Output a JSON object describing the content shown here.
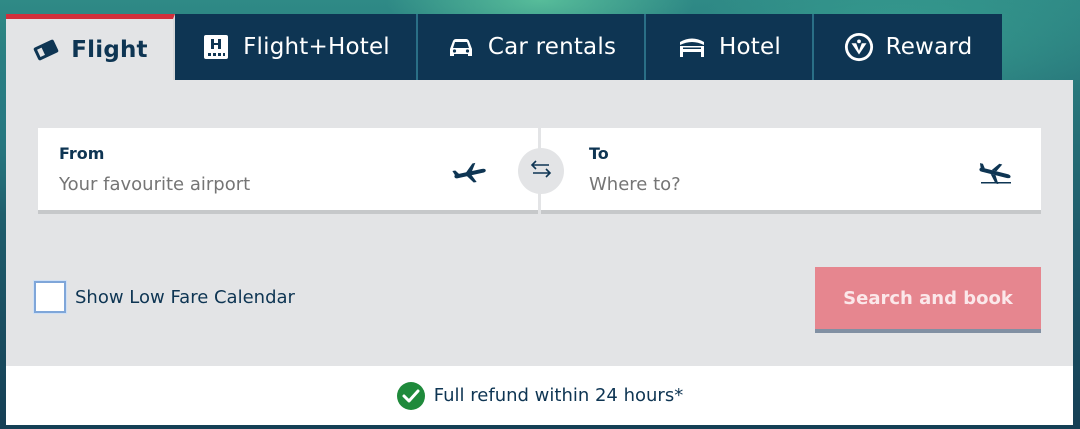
{
  "tabs": [
    {
      "label": "Flight",
      "icon": "ticket-icon",
      "active": true
    },
    {
      "label": "Flight+Hotel",
      "icon": "hotel-building-icon",
      "active": false
    },
    {
      "label": "Car rentals",
      "icon": "car-icon",
      "active": false
    },
    {
      "label": "Hotel",
      "icon": "bed-icon",
      "active": false
    },
    {
      "label": "Reward",
      "icon": "reward-badge-icon",
      "active": false
    }
  ],
  "from": {
    "label": "From",
    "placeholder": "Your favourite airport",
    "icon": "plane-takeoff-icon"
  },
  "to": {
    "label": "To",
    "placeholder": "Where to?",
    "icon": "plane-landing-icon"
  },
  "swap": {
    "icon": "swap-arrows-icon"
  },
  "low_fare": {
    "label": "Show Low Fare Calendar",
    "checked": false
  },
  "search": {
    "label": "Search and book"
  },
  "footer": {
    "text": "Full refund within 24 hours*",
    "icon": "check-circle-icon"
  },
  "colors": {
    "navy": "#0e3553",
    "panel": "#e3e4e6",
    "accent_red": "#d0303c",
    "button": "#e6868f",
    "check_green": "#1f8a3b"
  }
}
